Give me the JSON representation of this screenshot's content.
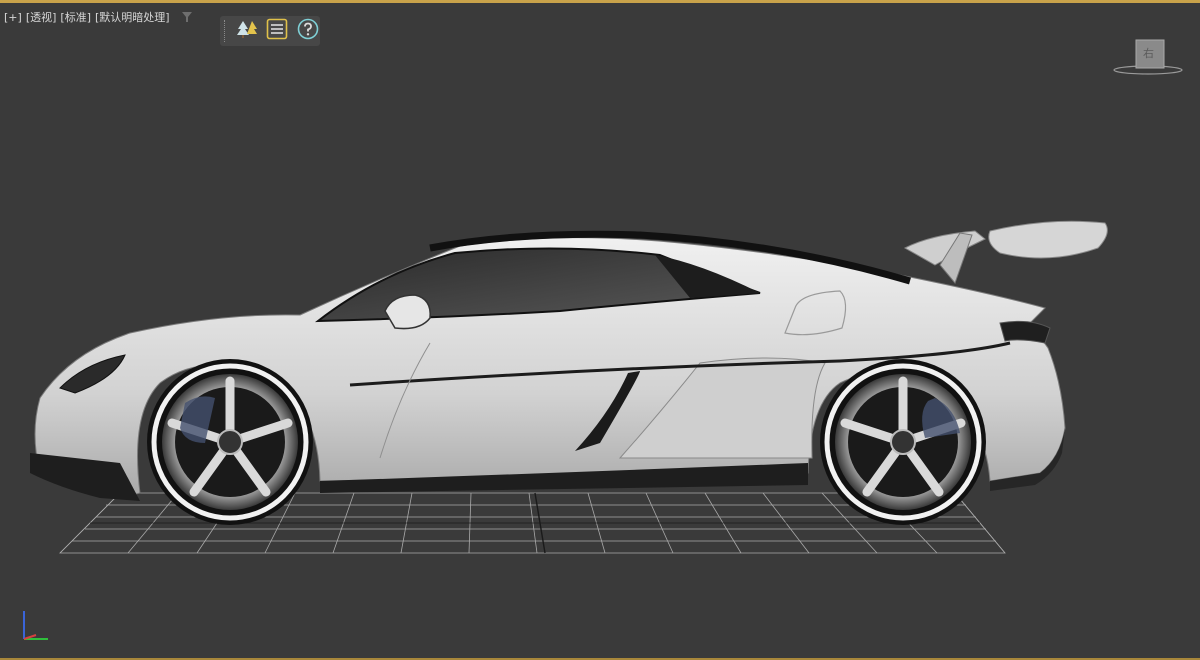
{
  "viewport": {
    "menu": {
      "plus_label": "[+]",
      "view_label": "[透视]",
      "shading_label": "[标准]",
      "lighting_label": "[默认明暗处理]"
    },
    "toolbar": {
      "items": [
        {
          "icon": "scene-explorer-icon"
        },
        {
          "icon": "list-icon"
        },
        {
          "icon": "help-icon"
        }
      ]
    },
    "viewcube": {
      "face_label": "右"
    },
    "colors": {
      "background": "#3a3a3a",
      "active_border": "#c8a24a",
      "car_body": "#d9d9d9",
      "grid": "#bdbdbd"
    }
  }
}
